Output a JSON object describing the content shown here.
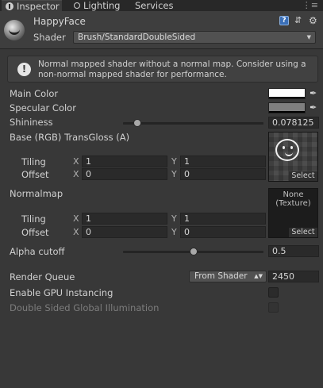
{
  "tabs": [
    {
      "label": "Inspector",
      "active": true
    },
    {
      "label": "Lighting",
      "active": false
    },
    {
      "label": "Services",
      "active": false
    }
  ],
  "header": {
    "material_name": "HappyFace",
    "shader_label": "Shader",
    "shader_value": "Brush/StandardDoubleSided",
    "icons": [
      "help-icon",
      "preset-icon",
      "gear-icon"
    ]
  },
  "warning": {
    "icon": "exclamation-icon",
    "text": "Normal mapped shader without a normal map. Consider using a non-normal mapped shader for performance."
  },
  "properties": {
    "main_color": {
      "label": "Main Color",
      "color": "#ffffff"
    },
    "specular_color": {
      "label": "Specular Color",
      "color": "#7f7f7f"
    },
    "shininess": {
      "label": "Shininess",
      "value": "0.078125",
      "slider_fraction": 0.078125
    },
    "base": {
      "label": "Base (RGB) TransGloss (A)",
      "select_label": "Select",
      "tiling_label": "Tiling",
      "offset_label": "Offset",
      "tiling_x": "1",
      "tiling_y": "1",
      "offset_x": "0",
      "offset_y": "0",
      "x_label": "X",
      "y_label": "Y"
    },
    "normalmap": {
      "label": "Normalmap",
      "none_text": "None\n(Texture)",
      "select_label": "Select",
      "tiling_label": "Tiling",
      "offset_label": "Offset",
      "tiling_x": "1",
      "tiling_y": "1",
      "offset_x": "0",
      "offset_y": "0",
      "x_label": "X",
      "y_label": "Y"
    },
    "alpha_cutoff": {
      "label": "Alpha cutoff",
      "value": "0.5",
      "slider_fraction": 0.5
    },
    "render_queue": {
      "label": "Render Queue",
      "mode": "From Shader",
      "value": "2450"
    },
    "gpu_instancing": {
      "label": "Enable GPU Instancing",
      "checked": false
    },
    "double_sided_gi": {
      "label": "Double Sided Global Illumination",
      "checked": false,
      "disabled": true
    }
  }
}
